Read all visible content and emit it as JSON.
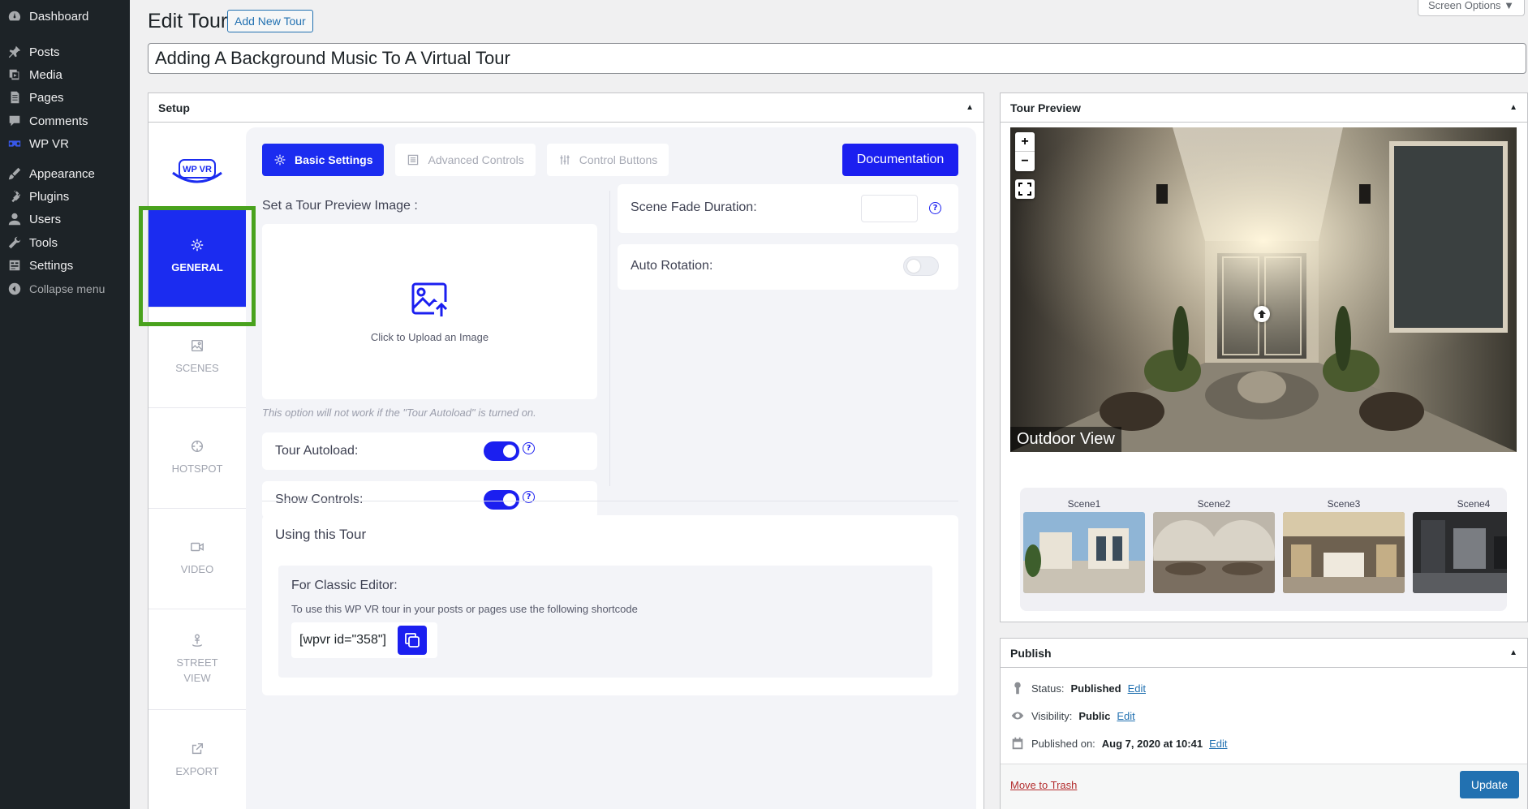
{
  "admin_menu": {
    "items": [
      {
        "label": "Dashboard",
        "icon": "dashboard-icon"
      },
      {
        "label": "Posts",
        "icon": "pin-icon"
      },
      {
        "label": "Media",
        "icon": "media-icon"
      },
      {
        "label": "Pages",
        "icon": "page-icon"
      },
      {
        "label": "Comments",
        "icon": "comment-icon"
      },
      {
        "label": "WP VR",
        "icon": "vr-icon"
      },
      {
        "label": "Appearance",
        "icon": "brush-icon"
      },
      {
        "label": "Plugins",
        "icon": "plug-icon"
      },
      {
        "label": "Users",
        "icon": "user-icon"
      },
      {
        "label": "Tools",
        "icon": "wrench-icon"
      },
      {
        "label": "Settings",
        "icon": "settings-icon"
      }
    ],
    "collapse_label": "Collapse menu"
  },
  "header": {
    "title": "Edit Tour",
    "add_new": "Add New Tour",
    "screen_options": "Screen Options ▼"
  },
  "post_title": "Adding A Background Music To A Virtual Tour",
  "setup": {
    "title": "Setup",
    "logo_text": "WP VR",
    "nav": {
      "general": "GENERAL",
      "scenes": "SCENES",
      "hotspot": "HOTSPOT",
      "video": "VIDEO",
      "street_view_1": "STREET",
      "street_view_2": "VIEW",
      "export": "EXPORT"
    },
    "tabs": {
      "basic": "Basic Settings",
      "advanced": "Advanced Controls",
      "control_buttons": "Control Buttons"
    },
    "documentation": "Documentation",
    "preview_image_label": "Set a Tour Preview Image :",
    "upload_text": "Click to Upload an Image",
    "autoload_note": "This option will not work if the \"Tour Autoload\" is turned on.",
    "tour_autoload": {
      "label": "Tour Autoload:",
      "on": true
    },
    "show_controls": {
      "label": "Show Controls:",
      "on": true
    },
    "scene_fade": {
      "label": "Scene Fade Duration:",
      "value": ""
    },
    "auto_rotation": {
      "label": "Auto Rotation:",
      "on": false
    },
    "info_glyph": "?",
    "using": {
      "title": "Using this Tour",
      "classic_title": "For Classic Editor:",
      "classic_desc": "To use this WP VR tour in your posts or pages use the following shortcode",
      "shortcode": "[wpvr id=\"358\"]"
    }
  },
  "tour_preview": {
    "title": "Tour Preview",
    "zoom_in": "+",
    "zoom_out": "−",
    "scene_title": "Outdoor View",
    "scenes": [
      "Scene1",
      "Scene2",
      "Scene3",
      "Scene4"
    ]
  },
  "publish": {
    "title": "Publish",
    "status_label": "Status:",
    "status_value": "Published",
    "visibility_label": "Visibility:",
    "visibility_value": "Public",
    "published_label": "Published on:",
    "published_value": "Aug 7, 2020 at 10:41",
    "edit": "Edit",
    "trash": "Move to Trash",
    "update": "Update"
  },
  "colors": {
    "accent": "#1b1ff0",
    "highlight": "#49a21d",
    "wp_blue": "#2271b1"
  }
}
